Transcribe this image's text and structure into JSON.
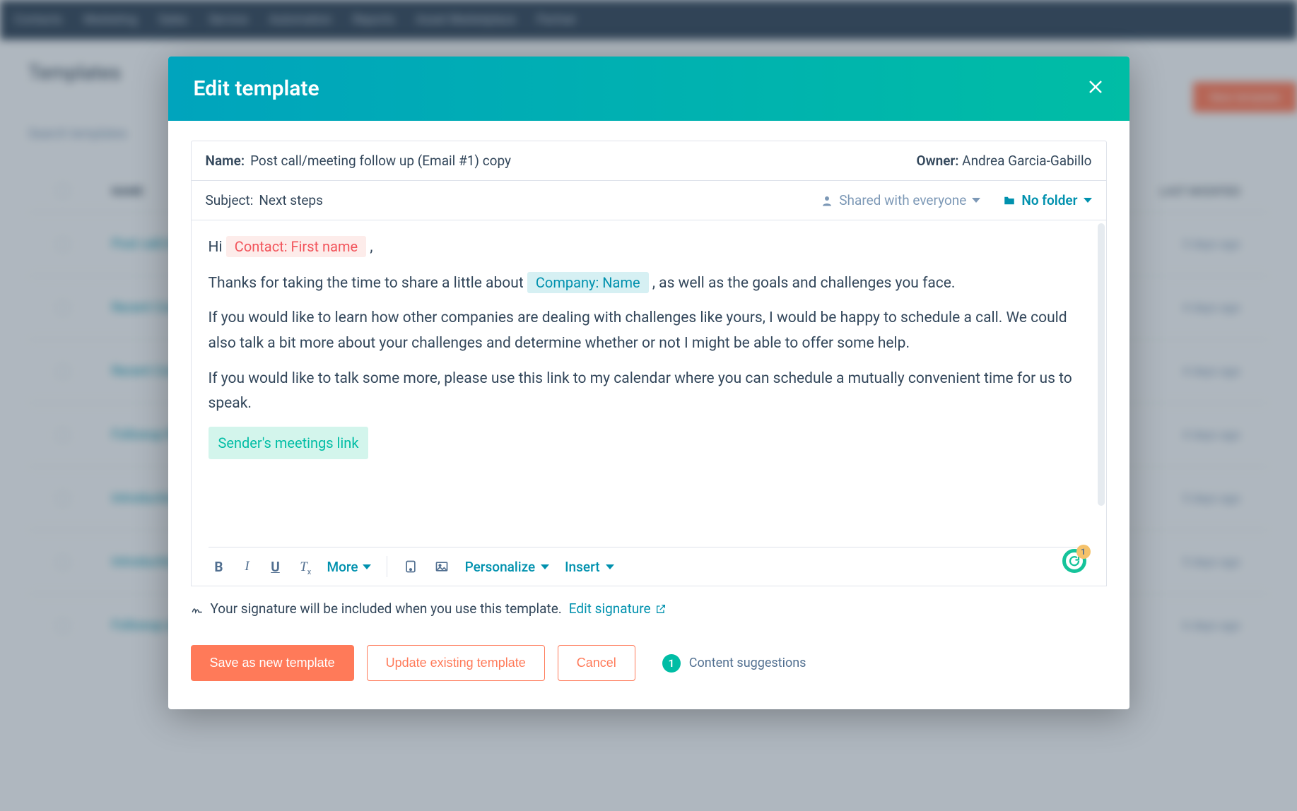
{
  "modal": {
    "title": "Edit template",
    "name_label": "Name:",
    "name_value": "Post call/meeting follow up (Email #1) copy",
    "owner_label": "Owner:",
    "owner_value": "Andrea Garcia-Gabillo",
    "subject_label": "Subject:",
    "subject_value": "Next steps",
    "shared_label": "Shared with everyone",
    "folder_label": "No folder"
  },
  "body": {
    "p1_pre": "Hi ",
    "token_contact": "Contact: First name",
    "p1_post": " ,",
    "p2_pre": " Thanks for taking the time to share a little about ",
    "token_company": "Company: Name",
    "p2_post": " , as well as the goals and challenges you face.",
    "p3": " If you would like to learn how other companies are dealing with challenges like yours, I would be happy to schedule a call. We could also talk a bit more about your challenges and determine whether or not I might be able to offer some help.",
    "p4": "If you would like to talk some more, please use this link to my calendar where you can schedule a mutually convenient time for us to speak.",
    "token_meeting": "Sender's meetings link"
  },
  "toolbar": {
    "bold": "B",
    "italic": "I",
    "underline": "U",
    "clear": "T",
    "more": "More",
    "personalize": "Personalize",
    "insert": "Insert"
  },
  "signature": {
    "text": "Your signature will be included when you use this template.",
    "link": "Edit signature"
  },
  "footer": {
    "save_new": "Save as new template",
    "update": "Update existing template",
    "cancel": "Cancel",
    "suggestions_count": "1",
    "suggestions_label": "Content suggestions"
  },
  "grammarly_badge": "1",
  "bg": {
    "page_title": "Templates",
    "search": "Search templates",
    "header_name": "NAME",
    "header_right": "LAST MODIFIED",
    "rows": [
      {
        "label": "Post call/meeti...",
        "right": "3 days ago"
      },
      {
        "label": "Recent Convers...",
        "right": "4 days ago"
      },
      {
        "label": "Recent Convers...",
        "right": "4 days ago"
      },
      {
        "label": "Followup Recen...",
        "right": "4 days ago"
      },
      {
        "label": "Introduction",
        "right": "5 days ago"
      },
      {
        "label": "Introduction",
        "right": "5 days ago"
      },
      {
        "label": "Followup after",
        "right": "6 days ago"
      }
    ]
  }
}
